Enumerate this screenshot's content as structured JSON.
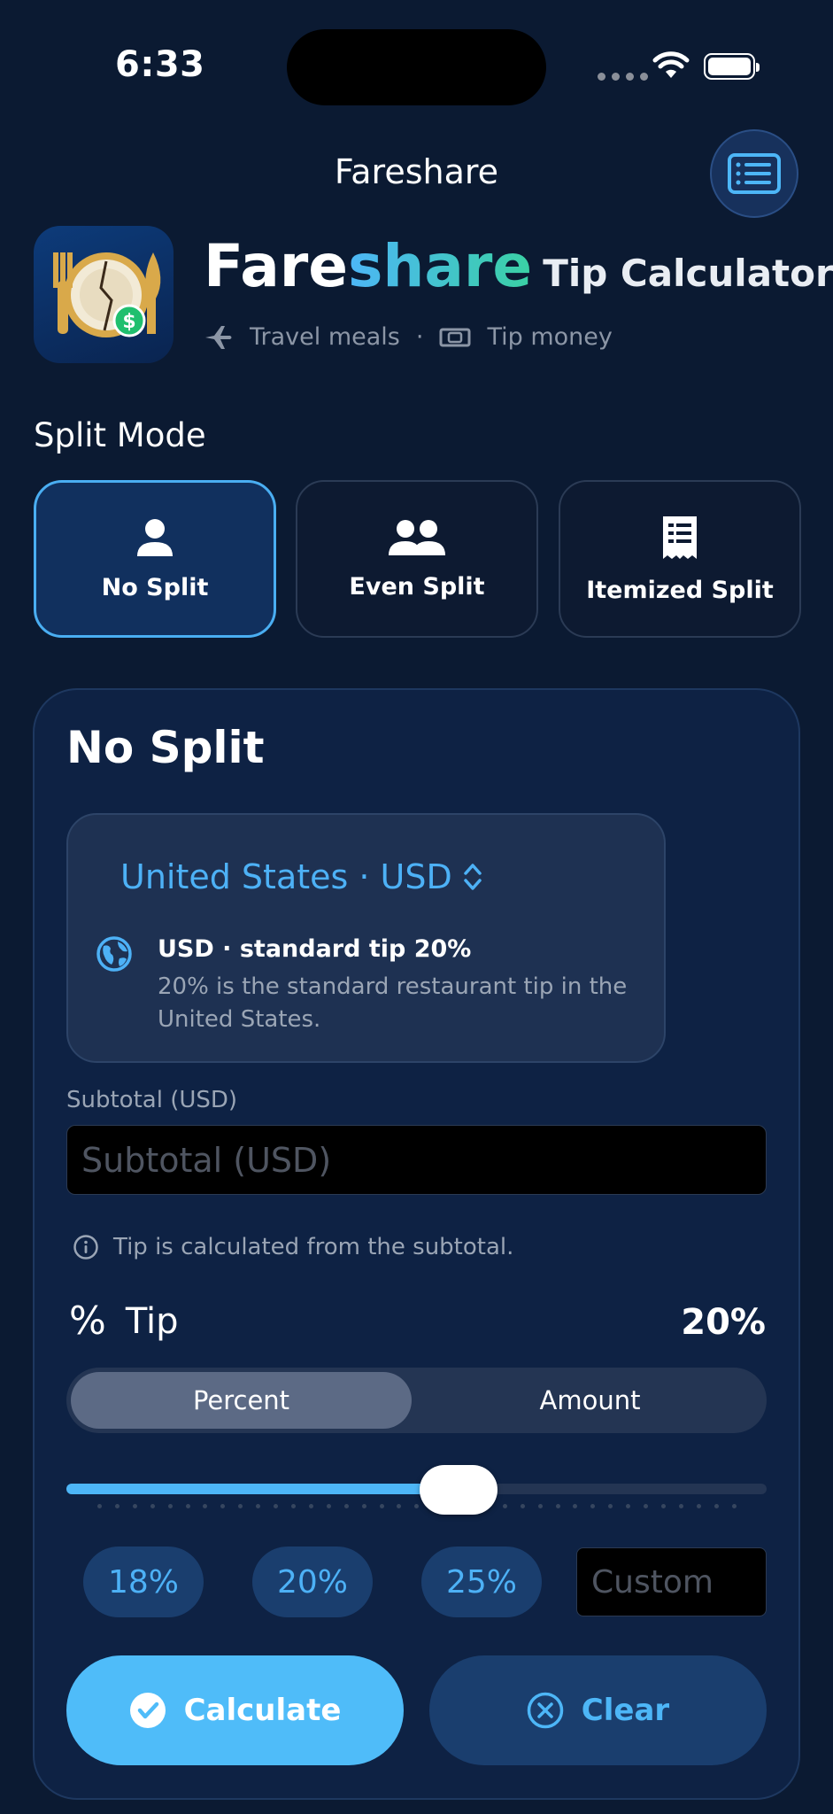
{
  "status": {
    "time": "6:33"
  },
  "nav": {
    "title": "Fareshare"
  },
  "header": {
    "brand_part1": "Fare",
    "brand_part2": "share",
    "brand_suffix": "Tip Calculator",
    "tags": [
      "Travel meals",
      "·",
      "Tip money"
    ]
  },
  "split_mode": {
    "label": "Split Mode",
    "options": [
      {
        "label": "No Split",
        "icon": "person-icon",
        "selected": true
      },
      {
        "label": "Even Split",
        "icon": "people-icon",
        "selected": false
      },
      {
        "label": "Itemized Split",
        "icon": "receipt-icon",
        "selected": false
      }
    ]
  },
  "card": {
    "title": "No Split",
    "country": {
      "selector": "United States · USD",
      "info_title": "USD · standard tip 20%",
      "info_desc": "20% is the standard restaurant tip in the United States."
    },
    "subtotal": {
      "label": "Subtotal (USD)",
      "placeholder": "Subtotal (USD)",
      "value": ""
    },
    "hint": "Tip is calculated from the subtotal.",
    "tip": {
      "symbol": "%",
      "label": "Tip",
      "value_text": "20%",
      "mode_options": [
        "Percent",
        "Amount"
      ],
      "mode_selected": "Percent",
      "slider_fraction": 0.56,
      "presets": [
        "18%",
        "20%",
        "25%"
      ],
      "custom_placeholder": "Custom"
    },
    "actions": {
      "calculate": "Calculate",
      "clear": "Clear"
    }
  },
  "colors": {
    "background": "#0b1a32",
    "accent": "#4db6f7",
    "brand_gradient_end": "#3ad1a4",
    "card": "#0e2244"
  }
}
